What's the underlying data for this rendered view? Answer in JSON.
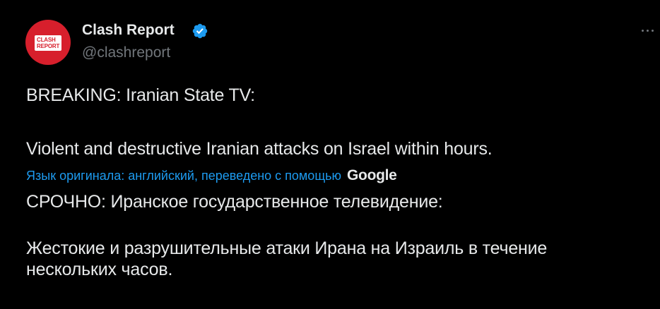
{
  "author": {
    "display_name": "Clash Report",
    "handle": "@clashreport",
    "avatar_text_line1": "CLASH",
    "avatar_text_line2": "REPORT",
    "verified": true
  },
  "tweet": {
    "original_line1": "BREAKING: Iranian State TV:",
    "original_line2": "Violent and destructive Iranian attacks on Israel within hours.",
    "translation_note": "Язык оригинала: английский, переведено с помощью",
    "translation_provider": "Google",
    "translated_line1": "СРОЧНО: Иранское государственное телевидение:",
    "translated_line2a": "Жестокие и разрушительные атаки Ирана на Израиль в течение",
    "translated_line2b": "нескольких часов."
  },
  "icons": {
    "verified": "verified-badge-icon",
    "more": "more-options-icon"
  },
  "colors": {
    "background": "#000000",
    "text": "#e7e9ea",
    "secondary_text": "#71767b",
    "accent": "#1d9bf0",
    "avatar_red": "#d71f2c"
  }
}
